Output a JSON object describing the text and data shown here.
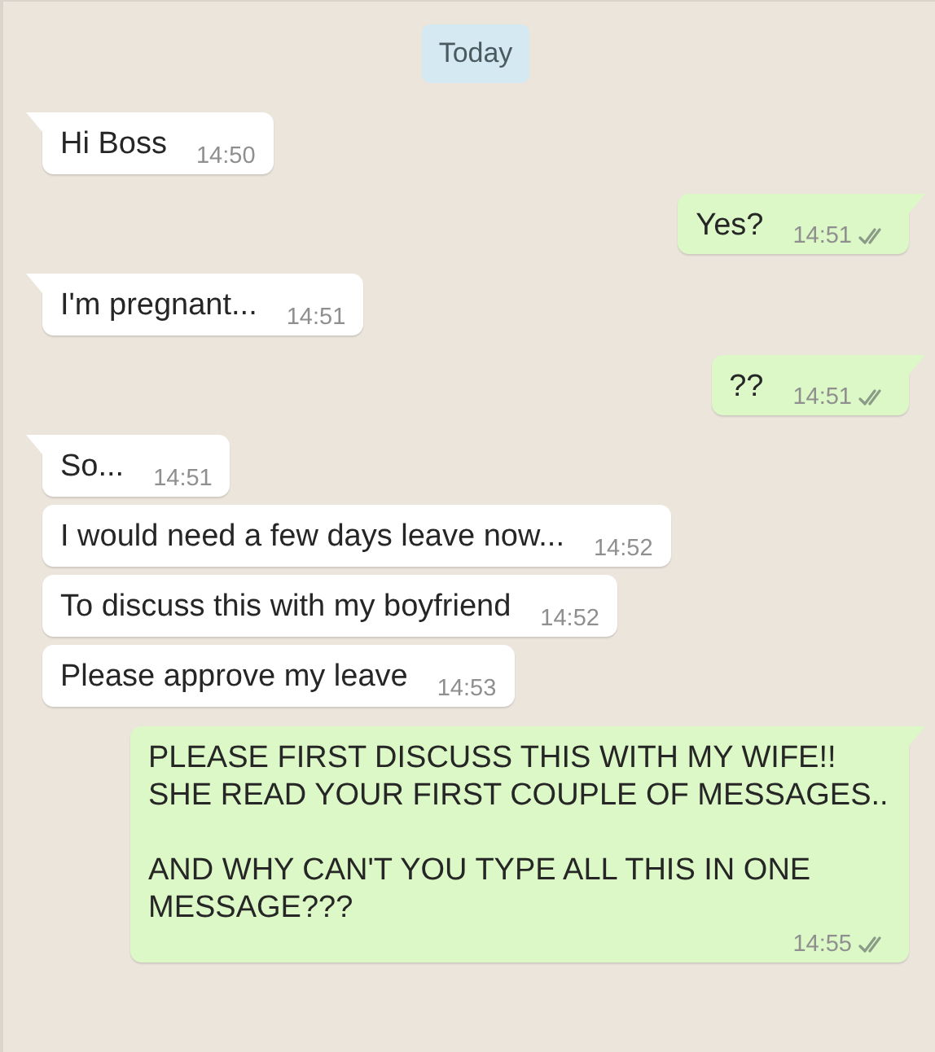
{
  "date_divider": "Today",
  "messages": [
    {
      "outgoing": false,
      "tail": true,
      "text": "Hi Boss",
      "time": "14:50"
    },
    {
      "outgoing": true,
      "tail": true,
      "text": "Yes?",
      "time": "14:51",
      "delivered": true
    },
    {
      "outgoing": false,
      "tail": true,
      "text": "I'm pregnant...",
      "time": "14:51"
    },
    {
      "outgoing": true,
      "tail": true,
      "text": "??",
      "time": "14:51",
      "delivered": true
    },
    {
      "outgoing": false,
      "tail": true,
      "text": "So...",
      "time": "14:51"
    },
    {
      "outgoing": false,
      "tail": false,
      "text": "I would need a few days leave now...",
      "time": "14:52"
    },
    {
      "outgoing": false,
      "tail": false,
      "text": "To discuss this with my boyfriend",
      "time": "14:52"
    },
    {
      "outgoing": false,
      "tail": false,
      "text": "Please approve my leave",
      "time": "14:53"
    },
    {
      "outgoing": true,
      "tail": true,
      "text": "PLEASE FIRST DISCUSS THIS WITH MY WIFE!! SHE READ YOUR FIRST COUPLE OF MESSAGES..\n\nAND WHY CAN'T YOU TYPE ALL THIS IN ONE MESSAGE???",
      "time": "14:55",
      "delivered": true
    }
  ]
}
